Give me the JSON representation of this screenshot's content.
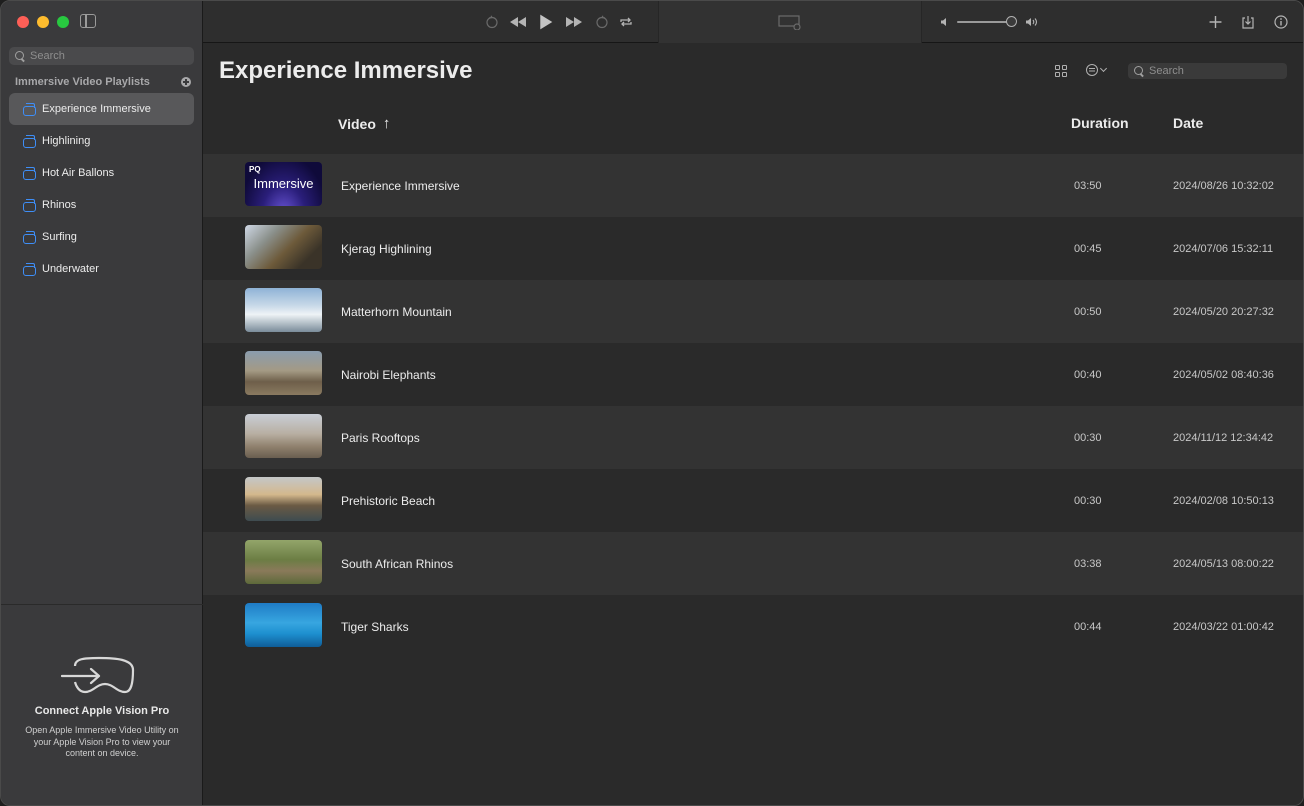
{
  "sidebar": {
    "search_placeholder": "Search",
    "section_title": "Immersive Video Playlists",
    "playlists": [
      {
        "label": "Experience Immersive",
        "selected": true
      },
      {
        "label": "Highlining",
        "selected": false
      },
      {
        "label": "Hot Air Ballons",
        "selected": false
      },
      {
        "label": "Rhinos",
        "selected": false
      },
      {
        "label": "Surfing",
        "selected": false
      },
      {
        "label": "Underwater",
        "selected": false
      }
    ],
    "connect": {
      "title": "Connect Apple Vision Pro",
      "description": "Open Apple Immersive Video Utility on your Apple Vision Pro to view your content on device."
    }
  },
  "main": {
    "title": "Experience Immersive",
    "search_placeholder": "Search",
    "columns": {
      "video": "Video",
      "duration": "Duration",
      "date": "Date"
    },
    "sort_indicator": "↑",
    "videos": [
      {
        "title": "Experience Immersive",
        "duration": "03:50",
        "date": "2024/08/26 10:32:02",
        "thumb_label_small": "PQ",
        "thumb_label_large": "Immersive"
      },
      {
        "title": "Kjerag Highlining",
        "duration": "00:45",
        "date": "2024/07/06 15:32:11"
      },
      {
        "title": "Matterhorn Mountain",
        "duration": "00:50",
        "date": "2024/05/20 20:27:32"
      },
      {
        "title": "Nairobi Elephants",
        "duration": "00:40",
        "date": "2024/05/02 08:40:36"
      },
      {
        "title": "Paris Rooftops",
        "duration": "00:30",
        "date": "2024/11/12 12:34:42"
      },
      {
        "title": "Prehistoric Beach",
        "duration": "00:30",
        "date": "2024/02/08 10:50:13"
      },
      {
        "title": "South African Rhinos",
        "duration": "03:38",
        "date": "2024/05/13 08:00:22"
      },
      {
        "title": "Tiger Sharks",
        "duration": "00:44",
        "date": "2024/03/22 01:00:42"
      }
    ]
  },
  "colors": {
    "accent_blue": "#3e8ef7",
    "close": "#fe5f57",
    "minimize": "#febc2e",
    "zoom": "#28c840"
  }
}
